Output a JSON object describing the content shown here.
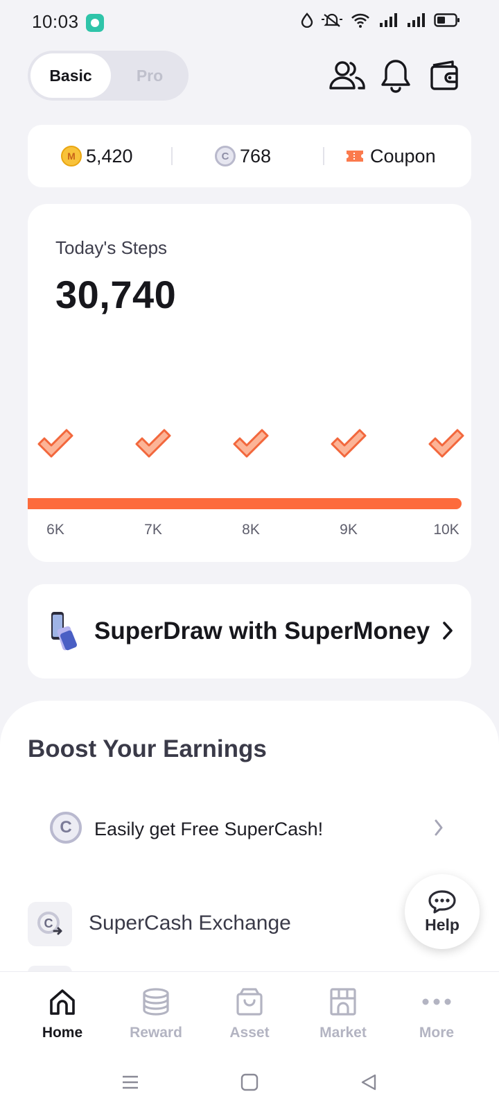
{
  "status_bar": {
    "time": "10:03",
    "icons": [
      "app-notification-icon",
      "data-saver-icon",
      "mute-icon",
      "wifi-icon",
      "signal-icon",
      "signal-icon",
      "battery-icon"
    ]
  },
  "header": {
    "mode_options": [
      "Basic",
      "Pro"
    ],
    "selected_mode": "Basic",
    "icons": [
      "friends-icon",
      "bell-icon",
      "wallet-icon"
    ]
  },
  "balances": {
    "supermoney": "5,420",
    "supercash": "768",
    "coupon_label": "Coupon"
  },
  "steps": {
    "label": "Today's Steps",
    "value": "30,740",
    "milestones": [
      "6K",
      "7K",
      "8K",
      "9K",
      "10K"
    ],
    "milestones_completed": 5,
    "progress_fraction": 1.0
  },
  "promo": {
    "title": "SuperDraw with SuperMoney"
  },
  "boost": {
    "title": "Boost Your Earnings",
    "items": [
      {
        "label": "Easily get Free SuperCash!"
      },
      {
        "label": "SuperCash Exchange"
      }
    ]
  },
  "help": {
    "label": "Help"
  },
  "tabs": [
    {
      "label": "Home",
      "icon": "home-icon",
      "active": true
    },
    {
      "label": "Reward",
      "icon": "coins-stack-icon",
      "active": false
    },
    {
      "label": "Asset",
      "icon": "bag-icon",
      "active": false
    },
    {
      "label": "Market",
      "icon": "store-icon",
      "active": false
    },
    {
      "label": "More",
      "icon": "more-dots-icon",
      "active": false
    }
  ],
  "colors": {
    "accent": "#fd6b3c",
    "background": "#f3f3f7",
    "inactive": "#b3b4c2"
  }
}
